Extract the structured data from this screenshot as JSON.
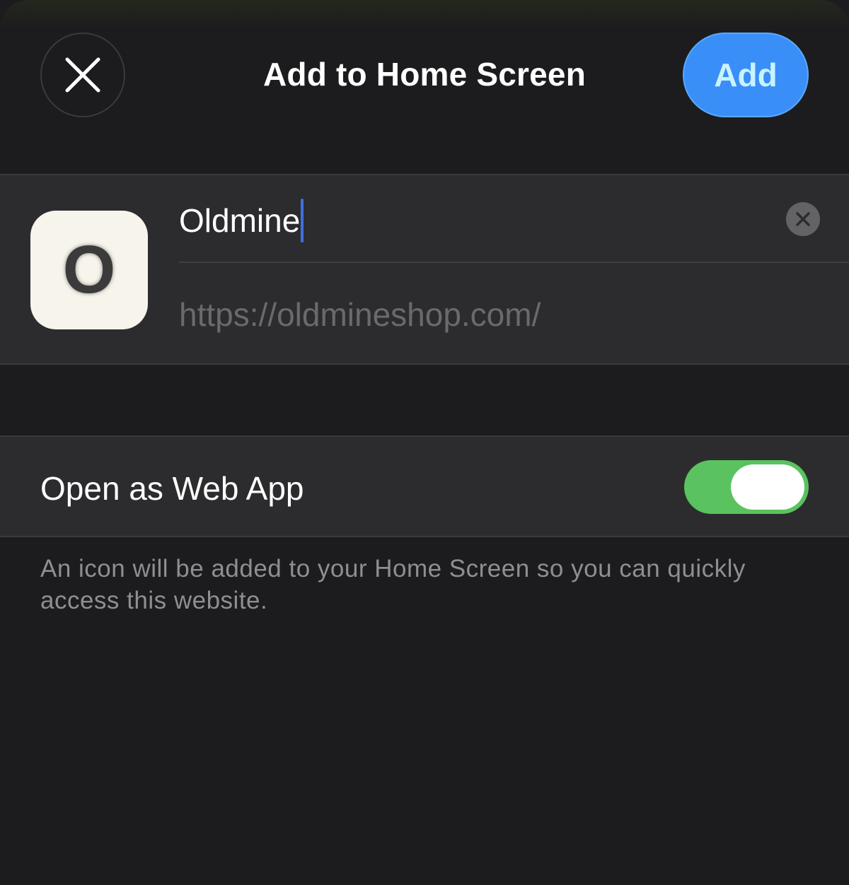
{
  "header": {
    "title": "Add to Home Screen",
    "add_label": "Add",
    "close_icon": "close-icon"
  },
  "app": {
    "icon_letter": "O",
    "name_value": "Oldmine",
    "url": "https://oldmineshop.com/",
    "clear_icon": "clear-text-icon"
  },
  "web_app": {
    "label": "Open as Web App",
    "enabled": true
  },
  "footer": {
    "note": "An icon will be added to your Home Screen so you can quickly access this website."
  },
  "colors": {
    "background": "#1c1c1e",
    "cell": "#2c2c2e",
    "accent": "#3a8ef7",
    "toggle_on": "#5ac25f",
    "caret": "#3f6fe3"
  }
}
